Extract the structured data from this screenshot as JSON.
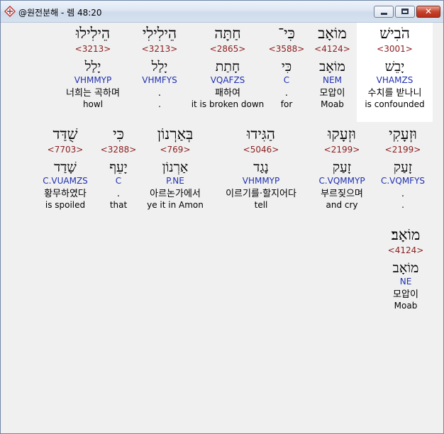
{
  "window": {
    "title": "@원전분해 - 렘 48:20",
    "close_glyph": "✕"
  },
  "rows": [
    [
      {
        "hebrew": "הֹבִישׁ",
        "strong": "<3001>",
        "lemma": "יָבֵשׁ",
        "parse": "VHAMZS",
        "korean": "수치를 받나니",
        "english": "is confounded",
        "selected": true
      },
      {
        "hebrew": "מוֹאָב",
        "strong": "<4124>",
        "lemma": "מוֹאָב",
        "parse": "NEM",
        "korean": "모압이",
        "english": "Moab"
      },
      {
        "hebrew": "כִּי־",
        "strong": "<3588>",
        "lemma": "כִּי",
        "parse": "C",
        "korean": ".",
        "english": "for"
      },
      {
        "hebrew": "חַתָּה",
        "strong": "<2865>",
        "lemma": "חָתַת",
        "parse": "VQAFZS",
        "korean": "패하여",
        "english": "it is broken down"
      },
      {
        "hebrew": "הֵילִילִי",
        "strong": "<3213>",
        "lemma": "יָלַל",
        "parse": "VHMFYS",
        "korean": ".",
        "english": "."
      },
      {
        "hebrew": "הֵילִילוּ",
        "strong": "<3213>",
        "lemma": "יָלַל",
        "parse": "VHMMYP",
        "korean": "너희는 곡하며",
        "english": "howl"
      }
    ],
    [
      {
        "hebrew": "וּזְעָקִי",
        "strong": "<2199>",
        "lemma": "זָעַק",
        "parse": "C.VQMFYS",
        "korean": ".",
        "english": "."
      },
      {
        "hebrew": "וּזְעָקוּ",
        "strong": "<2199>",
        "lemma": "זָעַק",
        "parse": "C.VQMMYP",
        "korean": "부르짖으며",
        "english": "and cry"
      },
      {
        "hebrew": "הַגִּידוּ",
        "strong": "<5046>",
        "lemma": "נָגַד",
        "parse": "VHMMYP",
        "korean": "이르기를·할지어다",
        "english": "tell"
      },
      {
        "hebrew": "בְּאַרְנוֹן",
        "strong": "<769>",
        "lemma": "אַרְנוֹן",
        "parse": "P.NE",
        "korean": "아르논가에서",
        "english": "ye it in Amon"
      },
      {
        "hebrew": "כִּי",
        "strong": "<3288>",
        "lemma": "יָעֵף",
        "parse": "C",
        "korean": ".",
        "english": "that"
      },
      {
        "hebrew": "שֻׁדַּד",
        "strong": "<7703>",
        "lemma": "שָׁדַד",
        "parse": "C.VUAMZS",
        "korean": "황무하였다",
        "english": "is spoiled"
      }
    ],
    [
      {
        "hebrew": "מוֹאָב׃",
        "strong": "<4124>",
        "lemma": "מוֹאָב",
        "parse": "NE",
        "korean": "모압이",
        "english": "Moab"
      }
    ]
  ]
}
